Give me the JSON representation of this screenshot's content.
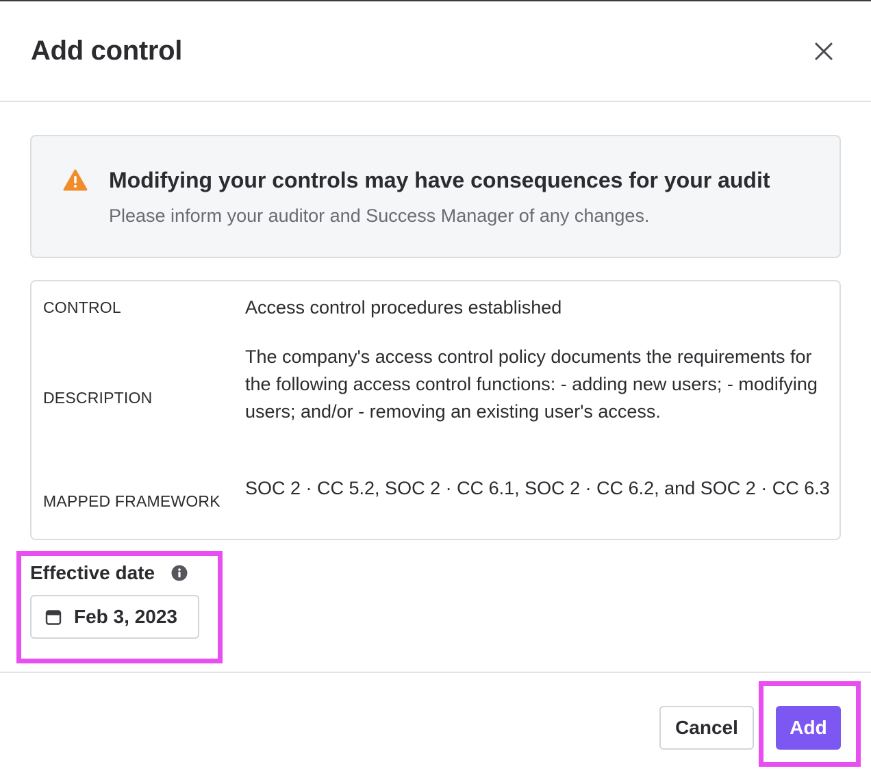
{
  "dialog": {
    "title": "Add control"
  },
  "alert": {
    "title": "Modifying your controls may have consequences for your audit",
    "message": "Please inform your auditor and Success Manager of any changes.",
    "icon": "warning-triangle-icon",
    "icon_color": "#f08c2b"
  },
  "details": {
    "control_label": "CONTROL",
    "control_value": "Access control procedures established",
    "description_label": "DESCRIPTION",
    "description_value": "The company's access control policy documents the requirements for the following access control functions: - adding new users; - modifying users; and/or - removing an existing user's access.",
    "framework_label": "MAPPED FRAMEWORK",
    "framework_value": "SOC 2 · CC 5.2, SOC 2 · CC 6.1, SOC 2 · CC 6.2, and SOC 2 · CC 6.3"
  },
  "effective_date": {
    "label": "Effective date",
    "value": "Feb 3, 2023",
    "info_icon": "info-icon",
    "calendar_icon": "calendar-icon"
  },
  "footer": {
    "cancel_label": "Cancel",
    "add_label": "Add"
  },
  "colors": {
    "primary": "#7d57f2",
    "highlight": "#e84ef0",
    "warning": "#f08c2b"
  }
}
